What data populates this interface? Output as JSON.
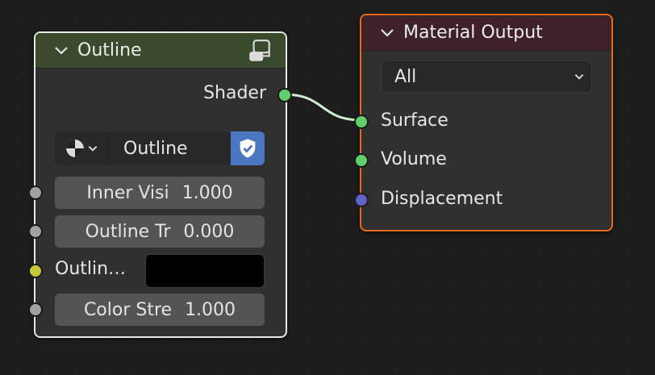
{
  "outline_node": {
    "title": "Outline",
    "header_icon": "node-group-icon",
    "output_socket_label": "Shader",
    "group_selector": {
      "browse_icon": "material-sphere-icon",
      "name": "Outline",
      "fake_user_icon": "shield-check-icon"
    },
    "inputs": [
      {
        "label": "Inner Visi",
        "value": "1.000"
      },
      {
        "label": "Outline Tr",
        "value": "0.000"
      },
      {
        "label": "Outlin…",
        "color": "#000000"
      },
      {
        "label": "Color Stre",
        "value": "1.000"
      }
    ]
  },
  "material_output_node": {
    "title": "Material Output",
    "target_select": "All",
    "inputs": [
      {
        "label": "Surface"
      },
      {
        "label": "Volume"
      },
      {
        "label": "Displacement"
      }
    ]
  },
  "colors": {
    "shader_socket": "#5fcf6a",
    "float_socket": "#a1a1a1",
    "color_socket": "#c8c738",
    "vector_socket": "#6363c7",
    "link": "#cfeccf",
    "active_node_border": "#e8681c"
  }
}
